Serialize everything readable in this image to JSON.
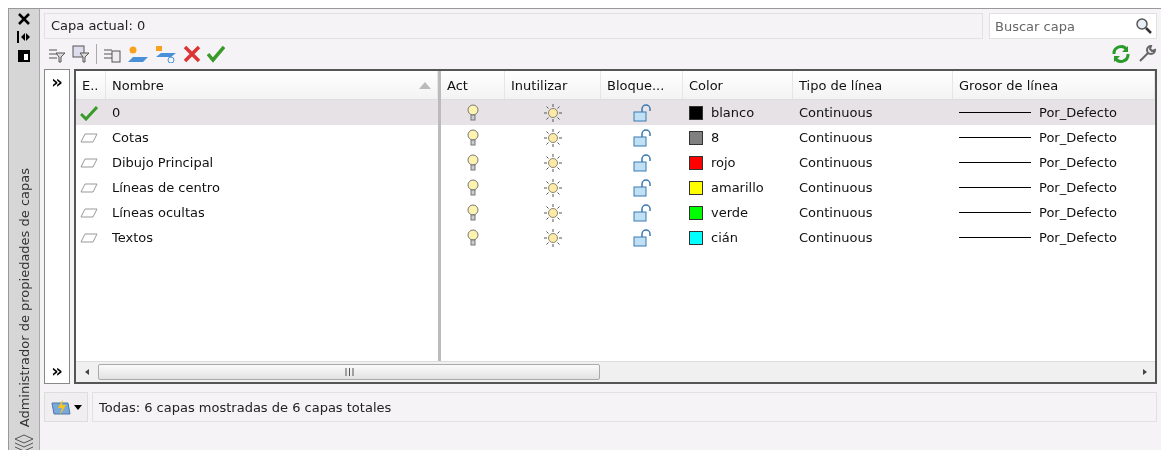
{
  "panel_title": "Administrador de propiedades de capas",
  "current_layer": "Capa actual: 0",
  "search": {
    "placeholder": "Buscar capa"
  },
  "expand_buttons": [
    "»",
    "»"
  ],
  "columns": [
    "E..",
    "Nombre",
    "Act",
    "Inutilizar",
    "Bloque...",
    "Color",
    "Tipo de línea",
    "Grosor de línea"
  ],
  "layers": [
    {
      "name": "0",
      "current": true,
      "selected": true,
      "on": true,
      "frozen": false,
      "locked": false,
      "color": "#000000",
      "color_name": "blanco",
      "linetype": "Continuous",
      "lineweight": "Por_Defecto"
    },
    {
      "name": "Cotas",
      "current": false,
      "selected": false,
      "on": true,
      "frozen": false,
      "locked": false,
      "color": "#808080",
      "color_name": "8",
      "linetype": "Continuous",
      "lineweight": "Por_Defecto"
    },
    {
      "name": "Dibujo Principal",
      "current": false,
      "selected": false,
      "on": true,
      "frozen": false,
      "locked": false,
      "color": "#ff0000",
      "color_name": "rojo",
      "linetype": "Continuous",
      "lineweight": "Por_Defecto"
    },
    {
      "name": "Líneas de centro",
      "current": false,
      "selected": false,
      "on": true,
      "frozen": false,
      "locked": false,
      "color": "#ffff00",
      "color_name": "amarillo",
      "linetype": "Continuous",
      "lineweight": "Por_Defecto"
    },
    {
      "name": "Líneas ocultas",
      "current": false,
      "selected": false,
      "on": true,
      "frozen": false,
      "locked": false,
      "color": "#00ff00",
      "color_name": "verde",
      "linetype": "Continuous",
      "lineweight": "Por_Defecto"
    },
    {
      "name": "Textos",
      "current": false,
      "selected": false,
      "on": true,
      "frozen": false,
      "locked": false,
      "color": "#00ffff",
      "color_name": "cián",
      "linetype": "Continuous",
      "lineweight": "Por_Defecto"
    }
  ],
  "status": "Todas: 6 capas mostradas de 6 capas totales"
}
